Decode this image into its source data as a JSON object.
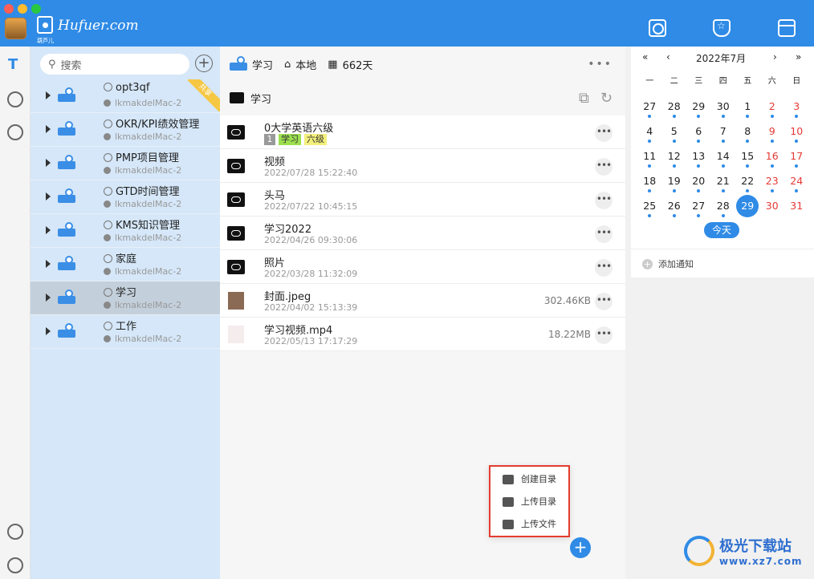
{
  "window": {
    "brand_logo_text": "Hufuer.com",
    "brand_small": "葫芦儿"
  },
  "projects": {
    "search_placeholder": "搜索",
    "items": [
      {
        "name": "opt3qf",
        "owner": "lkmakdelMac-2",
        "ribbon": "共享"
      },
      {
        "name": "OKR/KPI绩效管理",
        "owner": "lkmakdelMac-2"
      },
      {
        "name": "PMP项目管理",
        "owner": "lkmakdelMac-2"
      },
      {
        "name": "GTD时间管理",
        "owner": "lkmakdelMac-2"
      },
      {
        "name": "KMS知识管理",
        "owner": "lkmakdelMac-2"
      },
      {
        "name": "家庭",
        "owner": "lkmakdelMac-2"
      },
      {
        "name": "学习",
        "owner": "lkmakdelMac-2",
        "active": true
      },
      {
        "name": "工作",
        "owner": "lkmakdelMac-2"
      }
    ]
  },
  "files": {
    "header": {
      "project": "学习",
      "location": "本地",
      "days": "662天"
    },
    "path": "学习",
    "rows": [
      {
        "name": "0大学英语六级",
        "tags": [
          "1",
          "学习",
          "六级"
        ],
        "kind": "folder"
      },
      {
        "name": "视频",
        "date": "2022/07/28 15:22:40",
        "kind": "folder"
      },
      {
        "name": "头马",
        "date": "2022/07/22 10:45:15",
        "kind": "folder"
      },
      {
        "name": "学习2022",
        "date": "2022/04/26 09:30:06",
        "kind": "folder"
      },
      {
        "name": "照片",
        "date": "2022/03/28 11:32:09",
        "kind": "folder"
      },
      {
        "name": "封面.jpeg",
        "date": "2022/04/02 15:13:39",
        "size": "302.46KB",
        "kind": "image"
      },
      {
        "name": "学习视频.mp4",
        "date": "2022/05/13 17:17:29",
        "size": "18.22MB",
        "kind": "video"
      }
    ]
  },
  "popup": {
    "items": [
      "创建目录",
      "上传目录",
      "上传文件"
    ]
  },
  "calendar": {
    "title": "2022年7月",
    "nav": [
      "«",
      "‹",
      "›",
      "»"
    ],
    "weekdays": [
      "一",
      "二",
      "三",
      "四",
      "五",
      "六",
      "日"
    ],
    "weeks": [
      [
        "27",
        "28",
        "29",
        "30",
        "1",
        "2",
        "3"
      ],
      [
        "4",
        "5",
        "6",
        "7",
        "8",
        "9",
        "10"
      ],
      [
        "11",
        "12",
        "13",
        "14",
        "15",
        "16",
        "17"
      ],
      [
        "18",
        "19",
        "20",
        "21",
        "22",
        "23",
        "24"
      ],
      [
        "25",
        "26",
        "27",
        "28",
        "29",
        "30",
        "31"
      ]
    ],
    "today_label": "今天",
    "today": "29"
  },
  "notify": {
    "label": "添加通知"
  },
  "watermark": {
    "line1": "极光下载站",
    "line2": "www.xz7.com"
  },
  "colors": {
    "primary": "#2f8be6",
    "sidebar": "#d5e7f8",
    "highlight": "#e43c2f"
  }
}
